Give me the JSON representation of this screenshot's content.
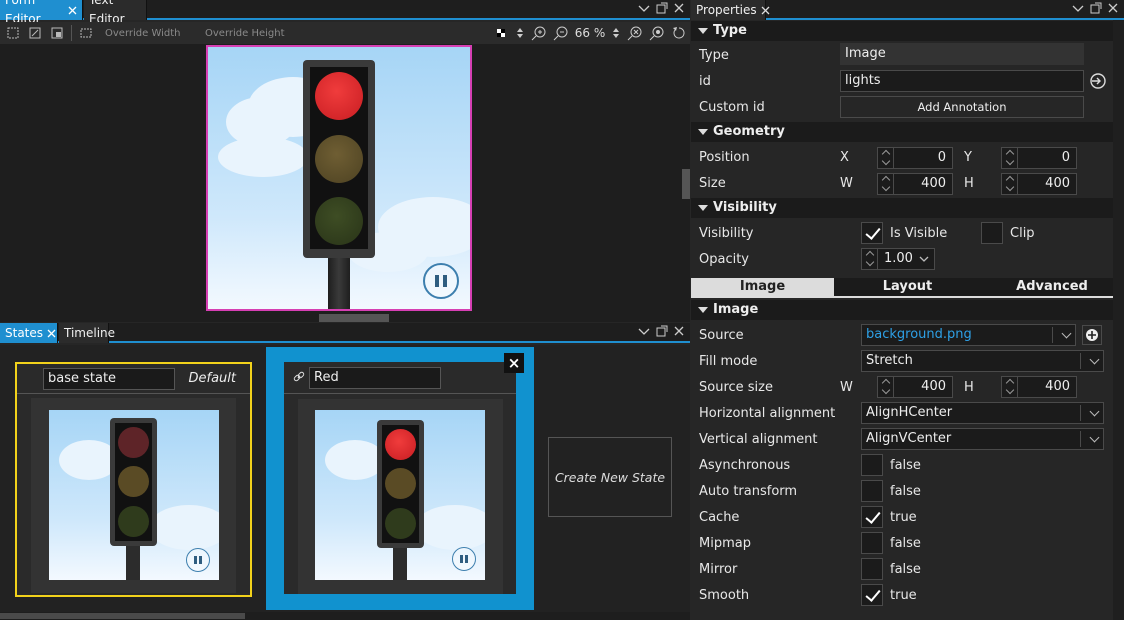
{
  "editor_tabs": [
    {
      "label": "Form Editor",
      "active": true
    },
    {
      "label": "Text Editor",
      "active": false
    }
  ],
  "toolbar": {
    "override_width": "Override Width",
    "override_height": "Override Height",
    "zoom": "66 %"
  },
  "bottom_tabs": [
    {
      "label": "States",
      "active": true
    },
    {
      "label": "Timeline",
      "active": false
    }
  ],
  "states": {
    "base": {
      "name": "base state",
      "default_label": "Default"
    },
    "red": {
      "name": "Red"
    },
    "create_label": "Create New State",
    "close_glyph": "×"
  },
  "properties": {
    "panel_title": "Properties",
    "sections": {
      "type": "Type",
      "geometry": "Geometry",
      "visibility": "Visibility",
      "image": "Image"
    },
    "type": {
      "label": "Type",
      "value": "Image"
    },
    "id": {
      "label": "id",
      "value": "lights"
    },
    "custom_id": {
      "label": "Custom id",
      "button": "Add Annotation"
    },
    "position": {
      "label": "Position",
      "x_label": "X",
      "x": "0",
      "y_label": "Y",
      "y": "0"
    },
    "size": {
      "label": "Size",
      "w_label": "W",
      "w": "400",
      "h_label": "H",
      "h": "400"
    },
    "visibility": {
      "label": "Visibility",
      "is_visible": "Is Visible",
      "clip": "Clip"
    },
    "opacity": {
      "label": "Opacity",
      "value": "1.00"
    },
    "subtabs": [
      {
        "label": "Image",
        "active": true
      },
      {
        "label": "Layout",
        "active": false
      },
      {
        "label": "Advanced",
        "active": false
      }
    ],
    "source": {
      "label": "Source",
      "value": "background.png"
    },
    "fill_mode": {
      "label": "Fill mode",
      "value": "Stretch"
    },
    "source_size": {
      "label": "Source size",
      "w_label": "W",
      "w": "400",
      "h_label": "H",
      "h": "400"
    },
    "halign": {
      "label": "Horizontal alignment",
      "value": "AlignHCenter"
    },
    "valign": {
      "label": "Vertical alignment",
      "value": "AlignVCenter"
    },
    "bools": [
      {
        "label": "Asynchronous",
        "value": "false",
        "checked": false
      },
      {
        "label": "Auto transform",
        "value": "false",
        "checked": false
      },
      {
        "label": "Cache",
        "value": "true",
        "checked": true
      },
      {
        "label": "Mipmap",
        "value": "false",
        "checked": false
      },
      {
        "label": "Mirror",
        "value": "false",
        "checked": false
      },
      {
        "label": "Smooth",
        "value": "true",
        "checked": true
      }
    ]
  },
  "colors": {
    "accent": "#1f8fd0",
    "selection_border": "#d63fb3",
    "base_state_border": "#f2d21b",
    "red_lamp": "#e4262a",
    "source_text": "#2ea0e6"
  }
}
